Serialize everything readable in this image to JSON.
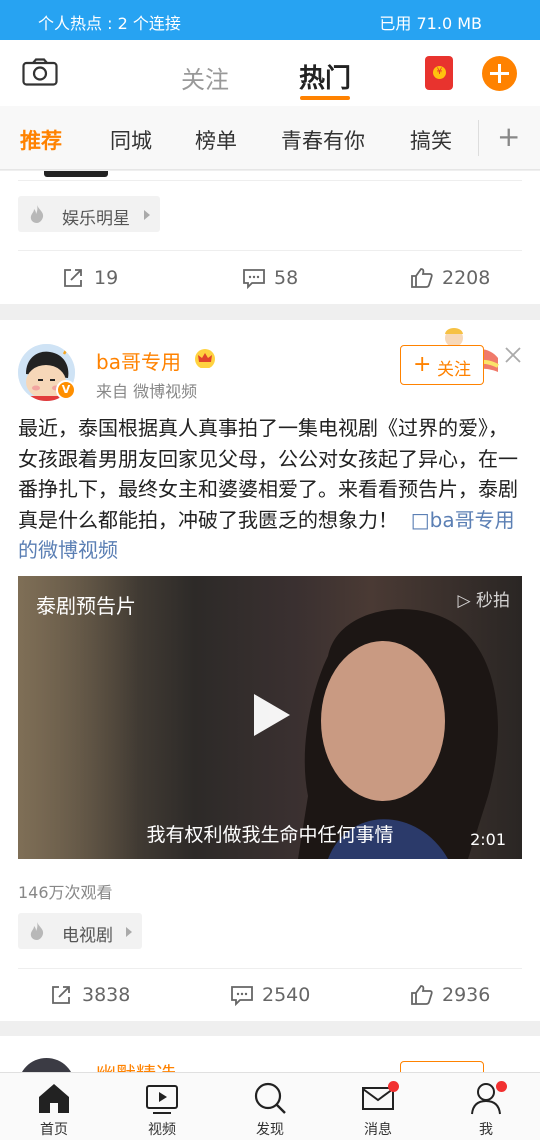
{
  "status_bar": {
    "hotspot": "个人热点 : 2 个连接",
    "data_used": "已用 71.0 MB"
  },
  "header": {
    "tab_follow": "关注",
    "tab_hot": "热门"
  },
  "categories": [
    "推荐",
    "同城",
    "榜单",
    "青春有你",
    "搞笑"
  ],
  "prev_card": {
    "tag": "娱乐明星",
    "reposts": "19",
    "comments": "58",
    "likes": "2208"
  },
  "post": {
    "username": "ba哥专用",
    "source": "来自 微博视频",
    "follow_label": "关注",
    "text": "最近，泰国根据真人真事拍了一集电视剧《过界的爱》，女孩跟着男朋友回家见父母，公公对女孩起了异心，在一番挣扎下，最终女主和婆婆相爱了。来看看预告片，泰剧真是什么都能拍，冲破了我匮乏的想象力！",
    "link_text": "ba哥专用的微博视频",
    "video": {
      "title": "泰剧预告片",
      "watermark": "秒拍",
      "subtitle": "我有权利做我生命中任何事情",
      "duration": "2:01"
    },
    "views": "146万次观看",
    "tag": "电视剧",
    "reposts": "3838",
    "comments": "2540",
    "likes": "2936"
  },
  "next_card": {
    "username": "幽默精选"
  },
  "bottom_nav": [
    {
      "label": "首页"
    },
    {
      "label": "视频"
    },
    {
      "label": "发现"
    },
    {
      "label": "消息"
    },
    {
      "label": "我"
    }
  ],
  "colors": {
    "accent": "#ff8200",
    "status_bar": "#27a3f2",
    "link": "#5b7fb4"
  }
}
